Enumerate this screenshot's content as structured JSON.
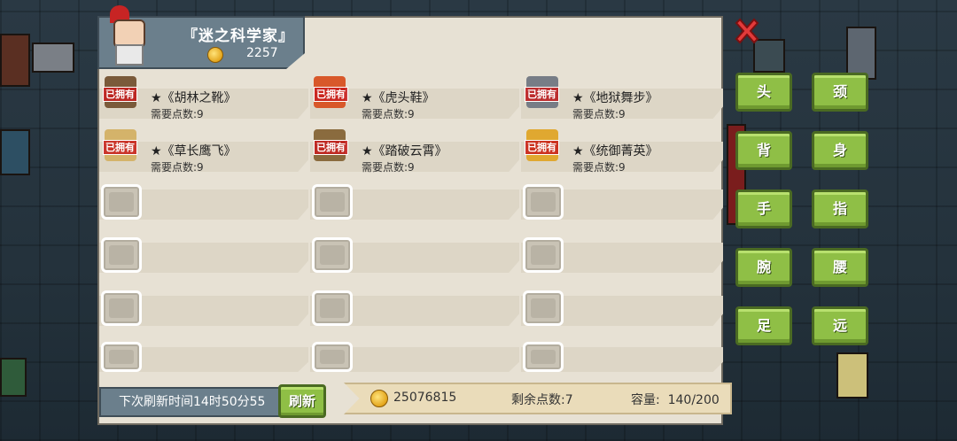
{
  "header": {
    "title": "『迷之科学家』",
    "coins": "2257"
  },
  "items": [
    {
      "name": "★《胡林之靴》",
      "cost": "需要点数:9",
      "owned": "已拥有",
      "icon": "boots-icon",
      "color": "#7a5a3a"
    },
    {
      "name": "★《虎头鞋》",
      "cost": "需要点数:9",
      "owned": "已拥有",
      "icon": "tiger-shoes-icon",
      "color": "#d8582a"
    },
    {
      "name": "★《地狱舞步》",
      "cost": "需要点数:9",
      "owned": "已拥有",
      "icon": "hell-dance-icon",
      "color": "#777d86"
    },
    {
      "name": "★《草长鹰飞》",
      "cost": "需要点数:9",
      "owned": "已拥有",
      "icon": "wing-icon",
      "color": "#d4b36a"
    },
    {
      "name": "★《踏破云霄》",
      "cost": "需要点数:9",
      "owned": "已拥有",
      "icon": "cloud-boots-icon",
      "color": "#8a6b3e"
    },
    {
      "name": "★《统御菁英》",
      "cost": "需要点数:9",
      "owned": "已拥有",
      "icon": "elite-icon",
      "color": "#e0a830"
    }
  ],
  "categories": [
    "头",
    "颈",
    "背",
    "身",
    "手",
    "指",
    "腕",
    "腰",
    "足",
    "远"
  ],
  "footer": {
    "refresh_time": "下次刷新时间14时50分55",
    "refresh_button": "刷新",
    "total_coins": "25076815",
    "remaining_points": "剩余点数:7",
    "capacity": "容量:  140/200"
  }
}
